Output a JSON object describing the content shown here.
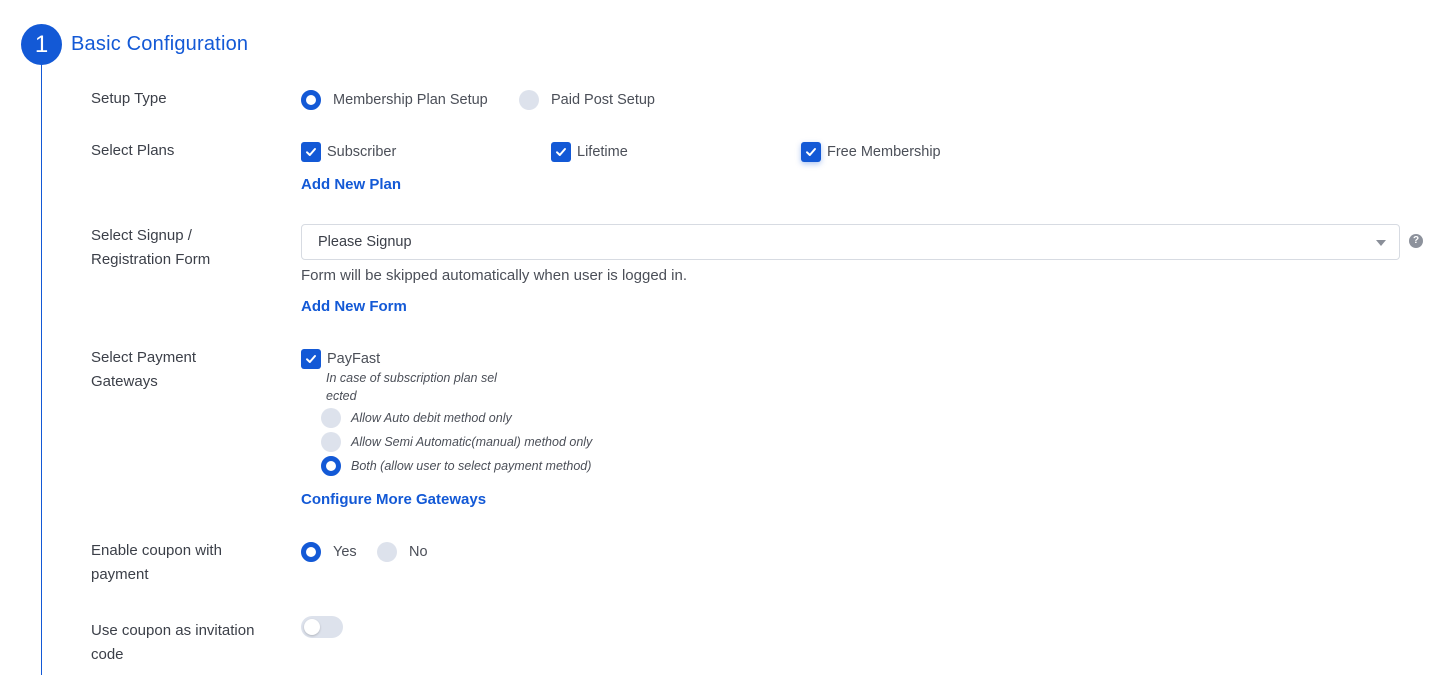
{
  "section": {
    "number": "1",
    "title": "Basic Configuration"
  },
  "setup_type": {
    "label": "Setup Type",
    "options": [
      "Membership Plan Setup",
      "Paid Post Setup"
    ],
    "selected": "Membership Plan Setup"
  },
  "plans": {
    "label": "Select Plans",
    "items": [
      {
        "name": "Subscriber",
        "checked": true
      },
      {
        "name": "Lifetime",
        "checked": true
      },
      {
        "name": "Free Membership",
        "checked": true
      }
    ],
    "add_link": "Add New Plan"
  },
  "signup": {
    "label_line1": "Select Signup /",
    "label_line2": "Registration Form",
    "value": "Please Signup",
    "hint": "Form will be skipped automatically when user is logged in.",
    "add_link": "Add New Form",
    "help_icon": "question-circle-icon"
  },
  "gateways": {
    "label_line1": "Select Payment",
    "label_line2": "Gateways",
    "gateway": "PayFast",
    "gateway_checked": true,
    "note_line1": "In case of subscription plan sel",
    "note_line2": "ected",
    "methods": [
      "Allow Auto debit method only",
      "Allow Semi Automatic(manual) method only",
      "Both (allow user to select payment method)"
    ],
    "selected_method": "Both (allow user to select payment method)",
    "configure_link": "Configure More Gateways"
  },
  "coupon": {
    "label_line1": "Enable coupon with",
    "label_line2": "payment",
    "options": [
      "Yes",
      "No"
    ],
    "selected": "Yes"
  },
  "invitation": {
    "label_line1": "Use coupon as invitation",
    "label_line2": "code",
    "enabled": false
  },
  "colors": {
    "accent": "#1359d6",
    "radio_off": "#dde2ec",
    "text": "#3b3f48"
  }
}
